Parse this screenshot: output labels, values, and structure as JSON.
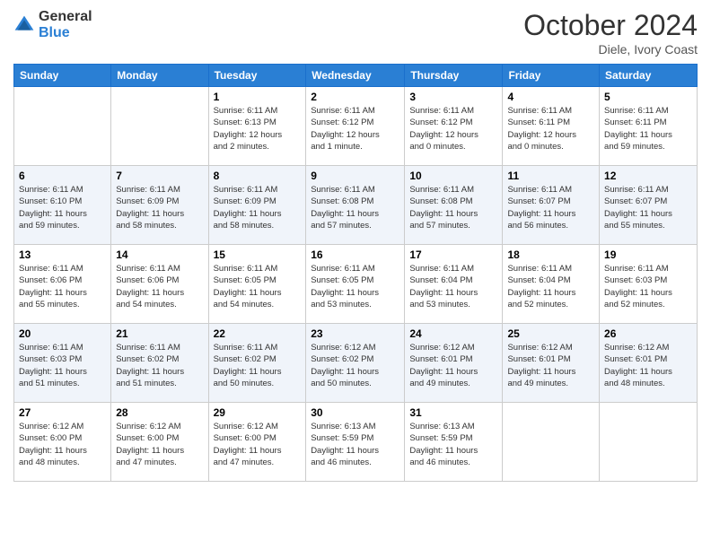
{
  "header": {
    "logo_general": "General",
    "logo_blue": "Blue",
    "month": "October 2024",
    "location": "Diele, Ivory Coast"
  },
  "days_of_week": [
    "Sunday",
    "Monday",
    "Tuesday",
    "Wednesday",
    "Thursday",
    "Friday",
    "Saturday"
  ],
  "weeks": [
    [
      {
        "day": "",
        "info": ""
      },
      {
        "day": "",
        "info": ""
      },
      {
        "day": "1",
        "info": "Sunrise: 6:11 AM\nSunset: 6:13 PM\nDaylight: 12 hours\nand 2 minutes."
      },
      {
        "day": "2",
        "info": "Sunrise: 6:11 AM\nSunset: 6:12 PM\nDaylight: 12 hours\nand 1 minute."
      },
      {
        "day": "3",
        "info": "Sunrise: 6:11 AM\nSunset: 6:12 PM\nDaylight: 12 hours\nand 0 minutes."
      },
      {
        "day": "4",
        "info": "Sunrise: 6:11 AM\nSunset: 6:11 PM\nDaylight: 12 hours\nand 0 minutes."
      },
      {
        "day": "5",
        "info": "Sunrise: 6:11 AM\nSunset: 6:11 PM\nDaylight: 11 hours\nand 59 minutes."
      }
    ],
    [
      {
        "day": "6",
        "info": "Sunrise: 6:11 AM\nSunset: 6:10 PM\nDaylight: 11 hours\nand 59 minutes."
      },
      {
        "day": "7",
        "info": "Sunrise: 6:11 AM\nSunset: 6:09 PM\nDaylight: 11 hours\nand 58 minutes."
      },
      {
        "day": "8",
        "info": "Sunrise: 6:11 AM\nSunset: 6:09 PM\nDaylight: 11 hours\nand 58 minutes."
      },
      {
        "day": "9",
        "info": "Sunrise: 6:11 AM\nSunset: 6:08 PM\nDaylight: 11 hours\nand 57 minutes."
      },
      {
        "day": "10",
        "info": "Sunrise: 6:11 AM\nSunset: 6:08 PM\nDaylight: 11 hours\nand 57 minutes."
      },
      {
        "day": "11",
        "info": "Sunrise: 6:11 AM\nSunset: 6:07 PM\nDaylight: 11 hours\nand 56 minutes."
      },
      {
        "day": "12",
        "info": "Sunrise: 6:11 AM\nSunset: 6:07 PM\nDaylight: 11 hours\nand 55 minutes."
      }
    ],
    [
      {
        "day": "13",
        "info": "Sunrise: 6:11 AM\nSunset: 6:06 PM\nDaylight: 11 hours\nand 55 minutes."
      },
      {
        "day": "14",
        "info": "Sunrise: 6:11 AM\nSunset: 6:06 PM\nDaylight: 11 hours\nand 54 minutes."
      },
      {
        "day": "15",
        "info": "Sunrise: 6:11 AM\nSunset: 6:05 PM\nDaylight: 11 hours\nand 54 minutes."
      },
      {
        "day": "16",
        "info": "Sunrise: 6:11 AM\nSunset: 6:05 PM\nDaylight: 11 hours\nand 53 minutes."
      },
      {
        "day": "17",
        "info": "Sunrise: 6:11 AM\nSunset: 6:04 PM\nDaylight: 11 hours\nand 53 minutes."
      },
      {
        "day": "18",
        "info": "Sunrise: 6:11 AM\nSunset: 6:04 PM\nDaylight: 11 hours\nand 52 minutes."
      },
      {
        "day": "19",
        "info": "Sunrise: 6:11 AM\nSunset: 6:03 PM\nDaylight: 11 hours\nand 52 minutes."
      }
    ],
    [
      {
        "day": "20",
        "info": "Sunrise: 6:11 AM\nSunset: 6:03 PM\nDaylight: 11 hours\nand 51 minutes."
      },
      {
        "day": "21",
        "info": "Sunrise: 6:11 AM\nSunset: 6:02 PM\nDaylight: 11 hours\nand 51 minutes."
      },
      {
        "day": "22",
        "info": "Sunrise: 6:11 AM\nSunset: 6:02 PM\nDaylight: 11 hours\nand 50 minutes."
      },
      {
        "day": "23",
        "info": "Sunrise: 6:12 AM\nSunset: 6:02 PM\nDaylight: 11 hours\nand 50 minutes."
      },
      {
        "day": "24",
        "info": "Sunrise: 6:12 AM\nSunset: 6:01 PM\nDaylight: 11 hours\nand 49 minutes."
      },
      {
        "day": "25",
        "info": "Sunrise: 6:12 AM\nSunset: 6:01 PM\nDaylight: 11 hours\nand 49 minutes."
      },
      {
        "day": "26",
        "info": "Sunrise: 6:12 AM\nSunset: 6:01 PM\nDaylight: 11 hours\nand 48 minutes."
      }
    ],
    [
      {
        "day": "27",
        "info": "Sunrise: 6:12 AM\nSunset: 6:00 PM\nDaylight: 11 hours\nand 48 minutes."
      },
      {
        "day": "28",
        "info": "Sunrise: 6:12 AM\nSunset: 6:00 PM\nDaylight: 11 hours\nand 47 minutes."
      },
      {
        "day": "29",
        "info": "Sunrise: 6:12 AM\nSunset: 6:00 PM\nDaylight: 11 hours\nand 47 minutes."
      },
      {
        "day": "30",
        "info": "Sunrise: 6:13 AM\nSunset: 5:59 PM\nDaylight: 11 hours\nand 46 minutes."
      },
      {
        "day": "31",
        "info": "Sunrise: 6:13 AM\nSunset: 5:59 PM\nDaylight: 11 hours\nand 46 minutes."
      },
      {
        "day": "",
        "info": ""
      },
      {
        "day": "",
        "info": ""
      }
    ]
  ]
}
